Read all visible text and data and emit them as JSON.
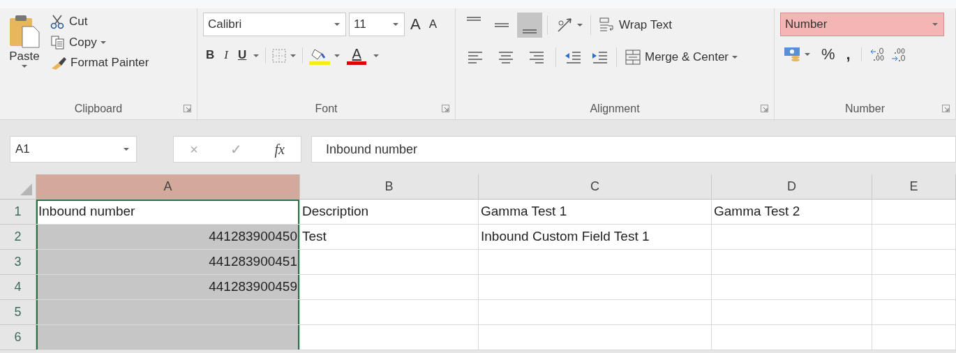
{
  "clipboard": {
    "paste": "Paste",
    "items": [
      {
        "kind": "cut",
        "label": "Cut",
        "has_menu": false
      },
      {
        "kind": "copy",
        "label": "Copy",
        "has_menu": true
      },
      {
        "kind": "painter",
        "label": "Format Painter",
        "has_menu": false
      }
    ],
    "label": "Clipboard"
  },
  "font": {
    "family": "Calibri",
    "size": "11",
    "grow": "A",
    "shrink": "A",
    "styles": [
      {
        "kind": "bold",
        "label": "B"
      },
      {
        "kind": "italic",
        "label": "I"
      },
      {
        "kind": "underline",
        "label": "U"
      }
    ],
    "font_color": "A",
    "label": "Font"
  },
  "alignment": {
    "vertical": [
      {
        "kind": "top",
        "selected": false
      },
      {
        "kind": "middle",
        "selected": false
      },
      {
        "kind": "bottom",
        "selected": true
      }
    ],
    "horizontal": [
      {
        "kind": "left",
        "selected": false
      },
      {
        "kind": "center",
        "selected": false
      },
      {
        "kind": "right",
        "selected": false
      }
    ],
    "wrap": "Wrap Text",
    "merge": "Merge & Center",
    "label": "Alignment"
  },
  "number": {
    "format": "Number",
    "highlighted": true,
    "percent": "%",
    "comma": ",",
    "label": "Number"
  },
  "formula_bar": {
    "name_box": "A1",
    "cancel": "×",
    "enter": "✓",
    "function": "fx",
    "formula": "Inbound number"
  },
  "sheet": {
    "columns": [
      {
        "label": "A",
        "selected": true
      },
      {
        "label": "B",
        "selected": false
      },
      {
        "label": "C",
        "selected": false
      },
      {
        "label": "D",
        "selected": false
      },
      {
        "label": "E",
        "selected": false
      }
    ],
    "rows": [
      {
        "label": "1",
        "cells": [
          {
            "text": "Inbound number",
            "kind": "text",
            "selected": true,
            "active": true
          },
          {
            "text": "Description",
            "kind": "text",
            "selected": false,
            "active": false
          },
          {
            "text": "Gamma Test 1",
            "kind": "text",
            "selected": false,
            "active": false
          },
          {
            "text": "Gamma Test 2",
            "kind": "text",
            "selected": false,
            "active": false
          },
          {
            "selected": false,
            "active": false
          }
        ]
      },
      {
        "label": "2",
        "cells": [
          {
            "text": "441283900450",
            "kind": "number",
            "selected": true,
            "active": false
          },
          {
            "text": "Test",
            "kind": "text",
            "selected": false,
            "active": false
          },
          {
            "text": "Inbound Custom Field Test 1",
            "kind": "text",
            "selected": false,
            "active": false
          },
          {
            "selected": false,
            "active": false
          },
          {
            "selected": false,
            "active": false
          }
        ]
      },
      {
        "label": "3",
        "cells": [
          {
            "text": "441283900451",
            "kind": "number",
            "selected": true,
            "active": false
          },
          {
            "selected": false,
            "active": false
          },
          {
            "selected": false,
            "active": false
          },
          {
            "selected": false,
            "active": false
          },
          {
            "selected": false,
            "active": false
          }
        ]
      },
      {
        "label": "4",
        "cells": [
          {
            "text": "441283900459",
            "kind": "number",
            "selected": true,
            "active": false
          },
          {
            "selected": false,
            "active": false
          },
          {
            "selected": false,
            "active": false
          },
          {
            "selected": false,
            "active": false
          },
          {
            "selected": false,
            "active": false
          }
        ]
      },
      {
        "label": "5",
        "cells": [
          {
            "selected": true,
            "active": false
          },
          {
            "selected": false,
            "active": false
          },
          {
            "selected": false,
            "active": false
          },
          {
            "selected": false,
            "active": false
          },
          {
            "selected": false,
            "active": false
          }
        ]
      },
      {
        "label": "6",
        "cells": [
          {
            "selected": true,
            "active": false
          },
          {
            "selected": false,
            "active": false
          },
          {
            "selected": false,
            "active": false
          },
          {
            "selected": false,
            "active": false
          },
          {
            "selected": false,
            "active": false
          }
        ]
      }
    ]
  }
}
